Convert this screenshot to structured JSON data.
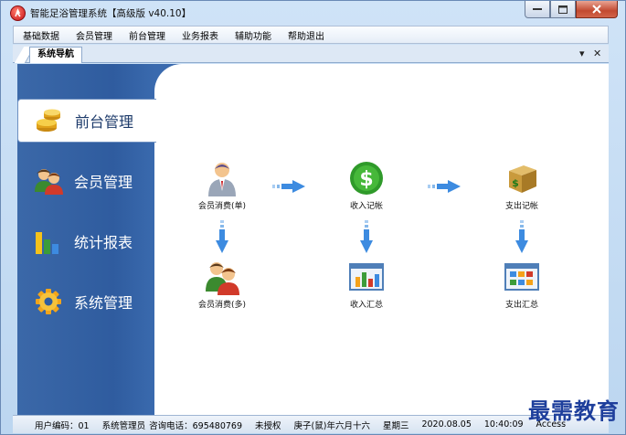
{
  "window": {
    "title": "智能足浴管理系统【高级版 v40.10】"
  },
  "menu": [
    "基础数据",
    "会员管理",
    "前台管理",
    "业务报表",
    "辅助功能",
    "帮助退出"
  ],
  "tab": {
    "label": "系统导航",
    "pin": "▾",
    "close": "✕"
  },
  "nav": {
    "items": [
      {
        "label": "前台管理",
        "icon": "coins-icon",
        "active": true
      },
      {
        "label": "会员管理",
        "icon": "members-icon",
        "active": false
      },
      {
        "label": "统计报表",
        "icon": "bar-chart-icon",
        "active": false
      },
      {
        "label": "系统管理",
        "icon": "gear-icon",
        "active": false
      }
    ]
  },
  "functions": {
    "member_single": "会员消费(单)",
    "income_record": "收入记帐",
    "expense_record": "支出记帐",
    "member_multi": "会员消费(多)",
    "income_summary": "收入汇总",
    "expense_summary": "支出汇总"
  },
  "status": {
    "user": "用户编码：01",
    "system": "系统管理员",
    "phone": "咨询电话：695480769",
    "license": "未授权",
    "lunar": "庚子(鼠)年六月十六",
    "weekday": "星期三",
    "date": "2020.08.05",
    "time": "10:40:09",
    "db": "Access"
  },
  "watermark": "最需教育",
  "colors": {
    "nav_blue": "#2f5c9f",
    "arrow_blue": "#3d8be0",
    "accent_red": "#c8141a"
  }
}
